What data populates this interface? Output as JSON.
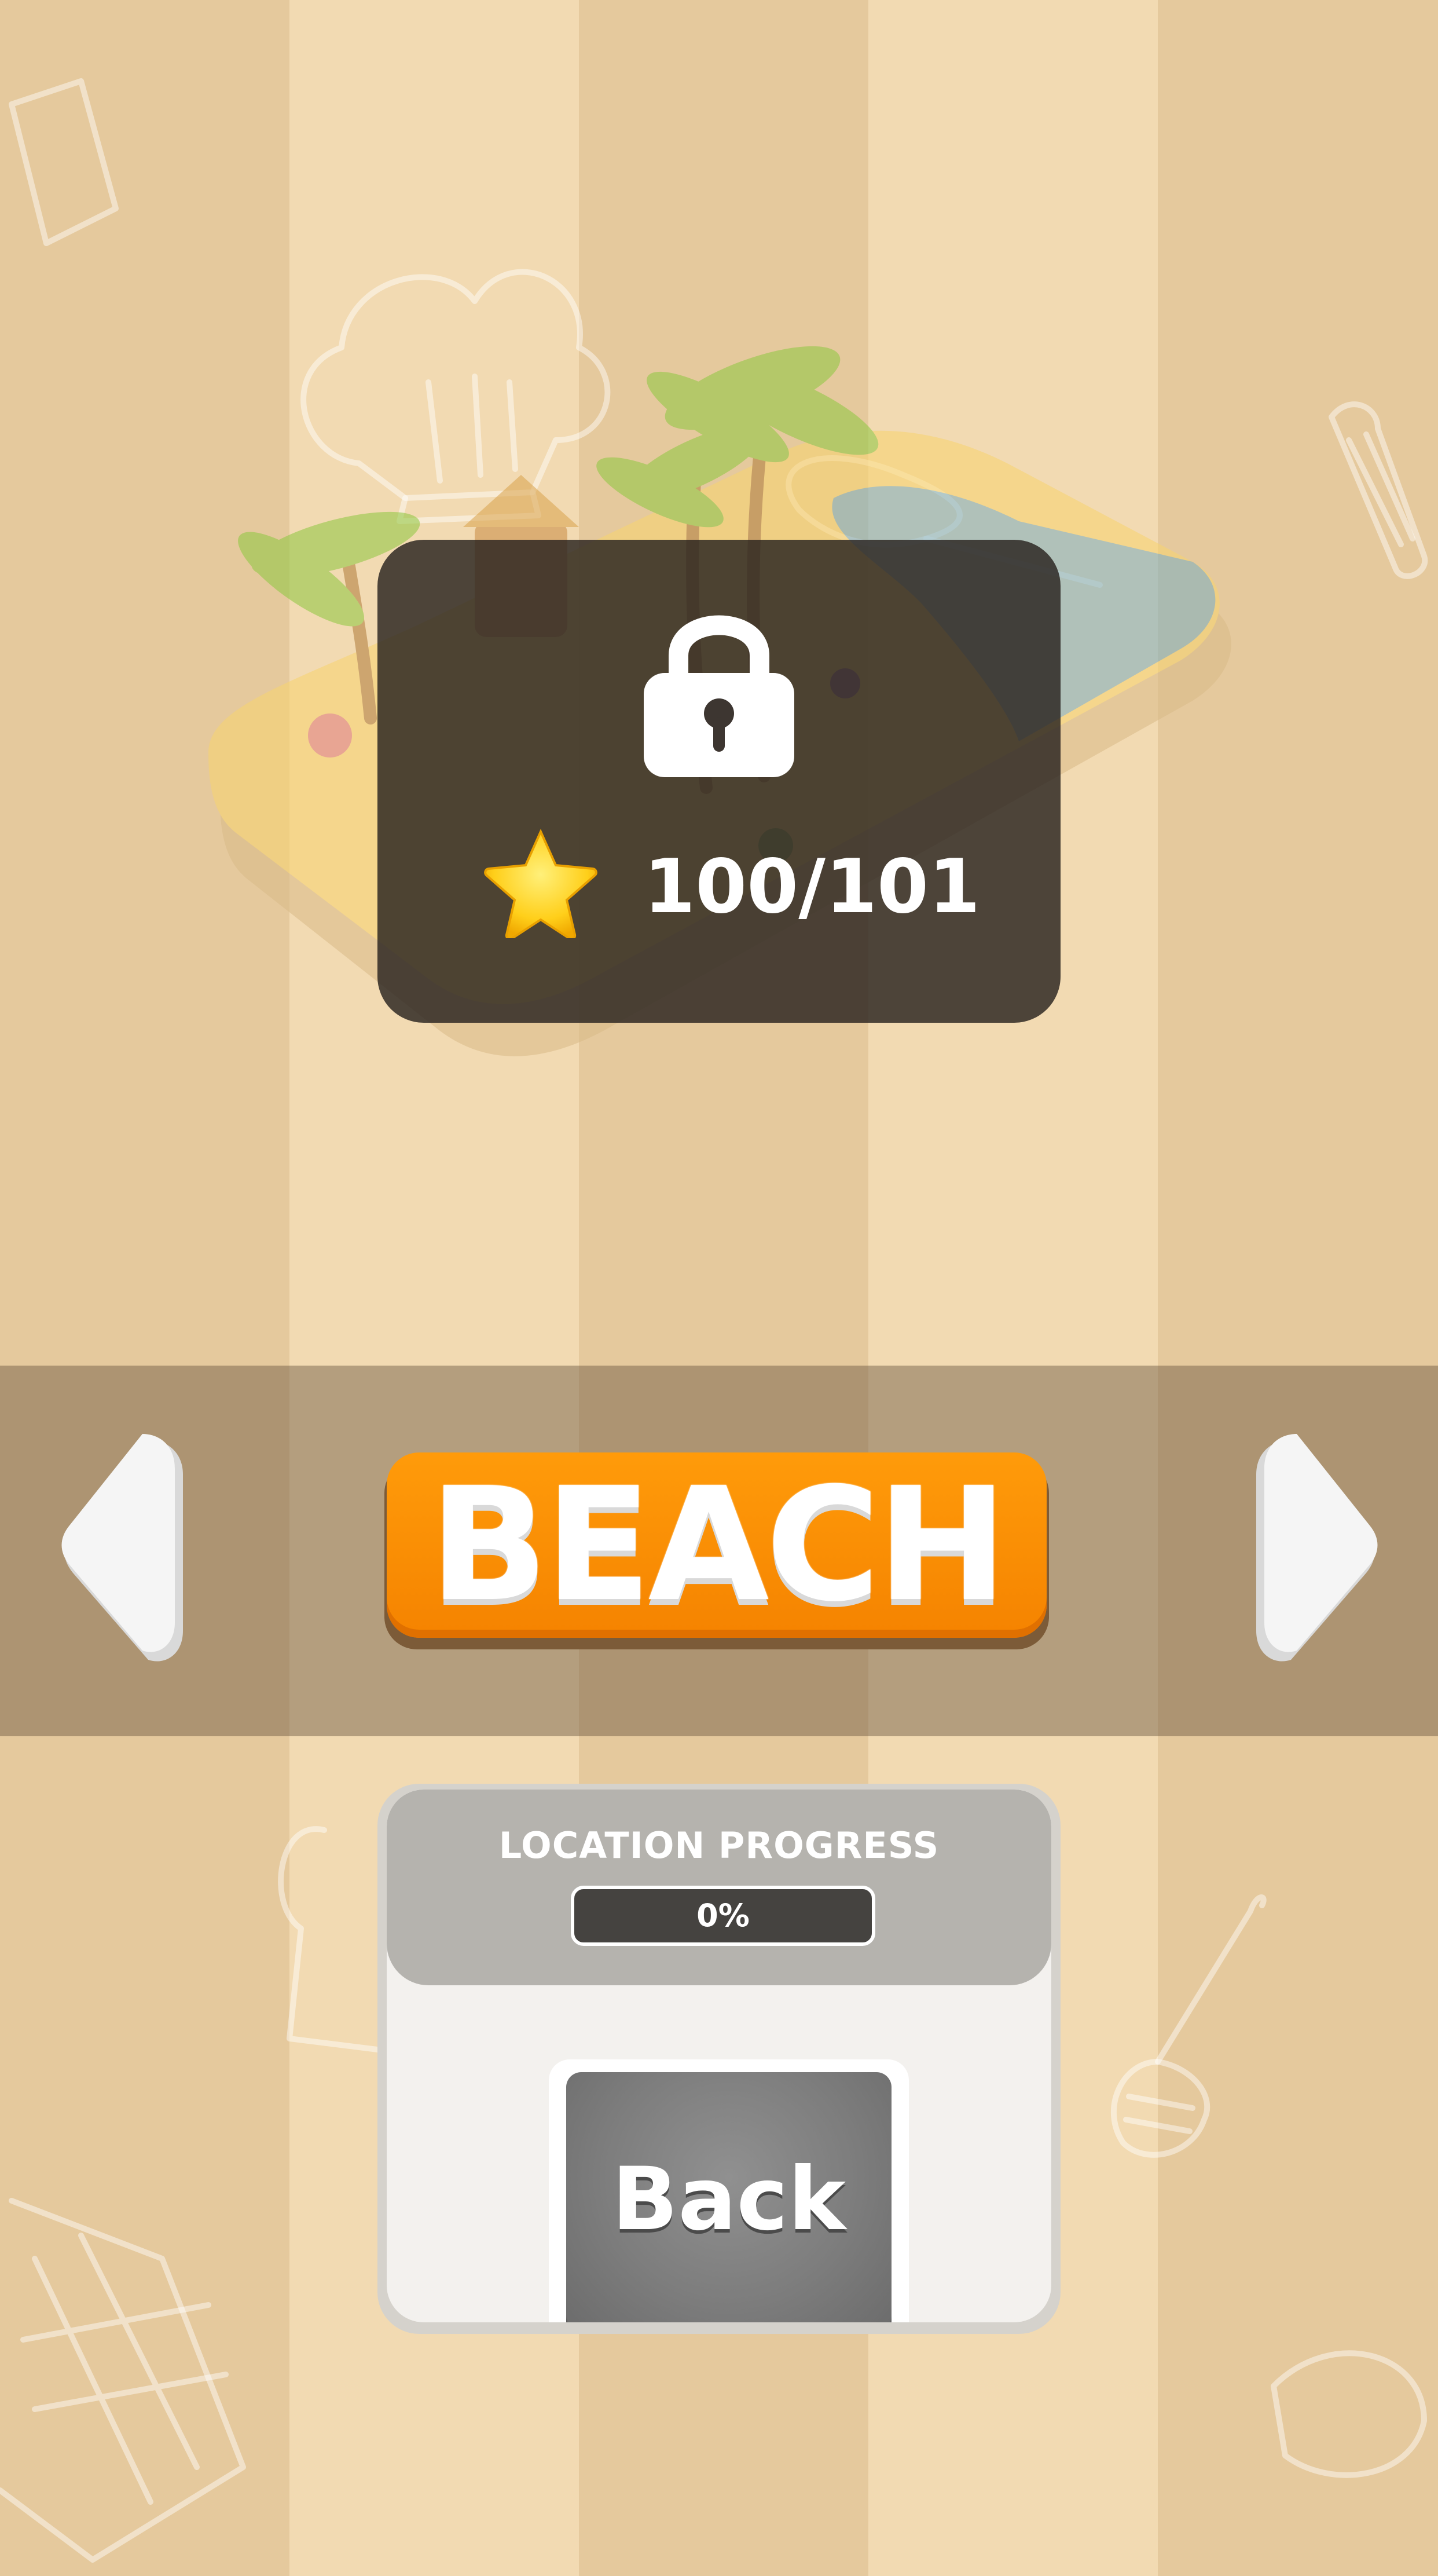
{
  "location": {
    "name": "BEACH",
    "locked": true
  },
  "lock_panel": {
    "stars_text": "100/101",
    "star_icon": "star-icon",
    "lock_icon": "padlock-icon"
  },
  "navigation": {
    "prev_icon": "chevron-left-icon",
    "next_icon": "chevron-right-icon"
  },
  "progress_card": {
    "label": "LOCATION PROGRESS",
    "percent_text": "0%",
    "progress_fraction": 0
  },
  "back_button": {
    "label": "Back"
  },
  "colors": {
    "accent_orange": "#f58300",
    "panel_dark": "#28221e",
    "stripe_light": "#f2dab2",
    "stripe_dark": "#e5c99d"
  }
}
